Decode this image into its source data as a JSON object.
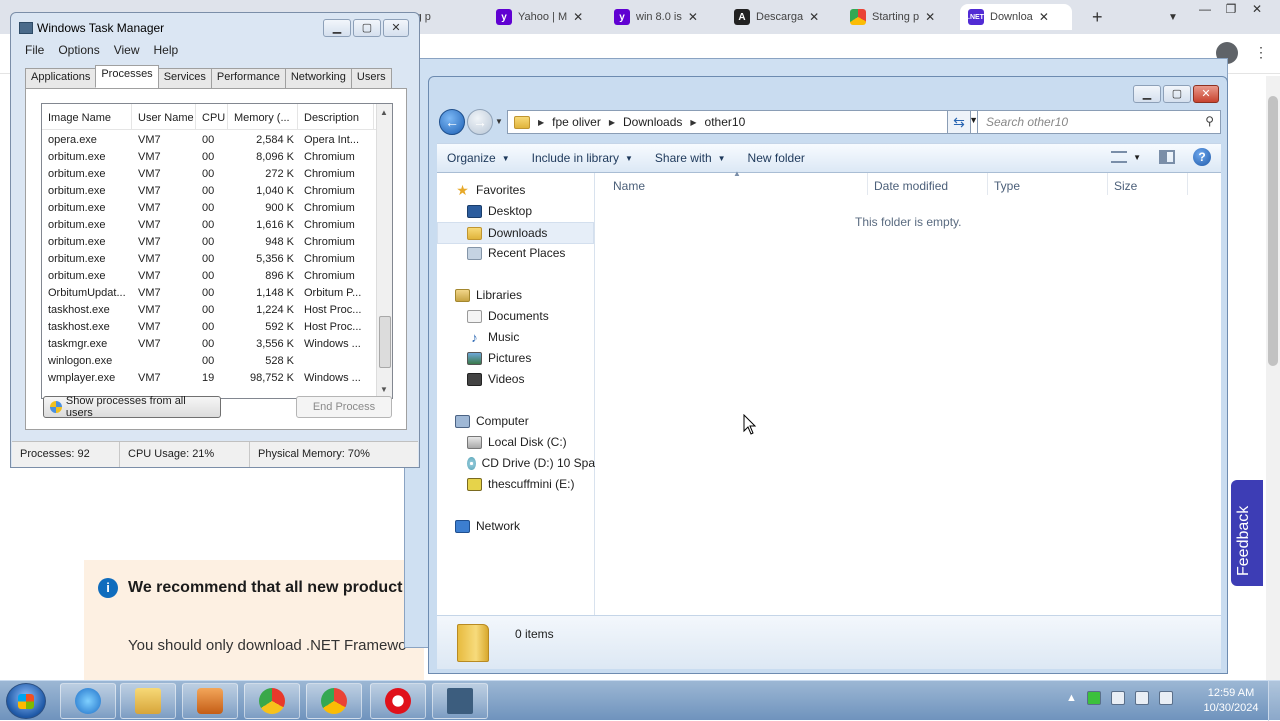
{
  "browser": {
    "tabs": [
      {
        "label": "ting p",
        "icon": "page-icon",
        "color": "#6b6b6b"
      },
      {
        "label": "Yahoo | M",
        "icon": "yahoo-icon",
        "color": "#6001d2"
      },
      {
        "label": "win 8.0 is",
        "icon": "yahoo-icon",
        "color": "#6001d2"
      },
      {
        "label": "Descarga",
        "icon": "site-icon",
        "color": "#222222"
      },
      {
        "label": "Starting p",
        "icon": "chrome-icon",
        "color": "#4caf50"
      },
      {
        "label": "Downloa",
        "icon": "dotnet-icon",
        "color": "#512bd4"
      }
    ],
    "new_tab": "+",
    "banner_bold": "We recommend that all new product application types, and deliver high pe",
    "banner_text": "You should only download .NET Framewo",
    "feedback": "Feedback"
  },
  "task_manager": {
    "title": "Windows Task Manager",
    "menu": [
      "File",
      "Options",
      "View",
      "Help"
    ],
    "tabs": [
      "Applications",
      "Processes",
      "Services",
      "Performance",
      "Networking",
      "Users"
    ],
    "active_tab": "Processes",
    "columns": [
      "Image Name",
      "User Name",
      "CPU",
      "Memory (...",
      "Description"
    ],
    "rows": [
      [
        "opera.exe",
        "VM7",
        "00",
        "2,584 K",
        "Opera Int..."
      ],
      [
        "orbitum.exe",
        "VM7",
        "00",
        "8,096 K",
        "Chromium"
      ],
      [
        "orbitum.exe",
        "VM7",
        "00",
        "272 K",
        "Chromium"
      ],
      [
        "orbitum.exe",
        "VM7",
        "00",
        "1,040 K",
        "Chromium"
      ],
      [
        "orbitum.exe",
        "VM7",
        "00",
        "900 K",
        "Chromium"
      ],
      [
        "orbitum.exe",
        "VM7",
        "00",
        "1,616 K",
        "Chromium"
      ],
      [
        "orbitum.exe",
        "VM7",
        "00",
        "948 K",
        "Chromium"
      ],
      [
        "orbitum.exe",
        "VM7",
        "00",
        "5,356 K",
        "Chromium"
      ],
      [
        "orbitum.exe",
        "VM7",
        "00",
        "896 K",
        "Chromium"
      ],
      [
        "OrbitumUpdat...",
        "VM7",
        "00",
        "1,148 K",
        "Orbitum P..."
      ],
      [
        "taskhost.exe",
        "VM7",
        "00",
        "1,224 K",
        "Host Proc..."
      ],
      [
        "taskhost.exe",
        "VM7",
        "00",
        "592 K",
        "Host Proc..."
      ],
      [
        "taskmgr.exe",
        "VM7",
        "00",
        "3,556 K",
        "Windows ..."
      ],
      [
        "winlogon.exe",
        "",
        "00",
        "528 K",
        ""
      ],
      [
        "wmplayer.exe",
        "VM7",
        "19",
        "98,752 K",
        "Windows ..."
      ]
    ],
    "show_all_button": "Show processes from all users",
    "end_process_button": "End Process",
    "status": {
      "processes": "Processes: 92",
      "cpu": "CPU Usage: 21%",
      "memory": "Physical Memory: 70%"
    }
  },
  "explorer": {
    "breadcrumb": [
      "fpe oliver",
      "Downloads",
      "other10"
    ],
    "search_placeholder": "Search other10",
    "commands": [
      "Organize",
      "Include in library",
      "Share with",
      "New folder"
    ],
    "nav": {
      "favorites": "Favorites",
      "desktop": "Desktop",
      "downloads": "Downloads",
      "recent": "Recent Places",
      "libraries": "Libraries",
      "documents": "Documents",
      "music": "Music",
      "pictures": "Pictures",
      "videos": "Videos",
      "computer": "Computer",
      "local_disk": "Local Disk (C:)",
      "cd_drive": "CD Drive (D:) 10 Spa",
      "usb": "thescuffmini (E:)",
      "network": "Network"
    },
    "columns": [
      "Name",
      "Date modified",
      "Type",
      "Size"
    ],
    "empty_message": "This folder is empty.",
    "items_count": "0 items"
  },
  "taskbar": {
    "time": "12:59 AM",
    "date": "10/30/2024"
  }
}
